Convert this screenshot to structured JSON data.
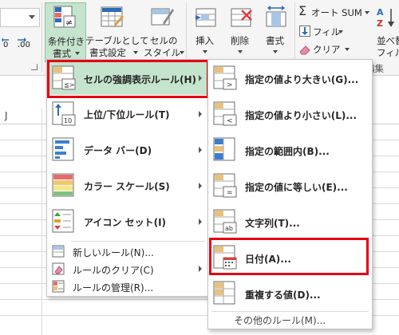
{
  "ribbon": {
    "dropdown_value": "",
    "numfmt_left": "0",
    "numfmt_right": ".00",
    "conditional_formatting_line1": "条件付き",
    "conditional_formatting_line2": "書式",
    "format_as_table_line1": "テーブルとして",
    "format_as_table_line2": "書式設定",
    "cell_styles_line1": "セルの",
    "cell_styles_line2": "スタイル",
    "insert": "挿入",
    "delete": "削除",
    "format": "書式",
    "autosum": "オート SUM",
    "fill": "フィル",
    "clear": "クリア",
    "sort_line1": "並べ替",
    "sort_line2": "フィル",
    "group_editing": "編集"
  },
  "sheet": {
    "column_header": "J"
  },
  "main_menu": {
    "items": [
      {
        "label": "セルの強調表示ルール(H)",
        "has_arrow": true
      },
      {
        "label": "上位/下位ルール(T)",
        "has_arrow": true
      },
      {
        "label": "データ バー(D)",
        "has_arrow": true
      },
      {
        "label": "カラー スケール(S)",
        "has_arrow": true
      },
      {
        "label": "アイコン セット(I)",
        "has_arrow": true
      }
    ],
    "small_items": [
      {
        "label": "新しいルール(N)..."
      },
      {
        "label": "ルールのクリア(C)",
        "has_arrow": true
      },
      {
        "label": "ルールの管理(R)..."
      }
    ]
  },
  "sub_menu": {
    "items": [
      {
        "label": "指定の値より大きい(G)..."
      },
      {
        "label": "指定の値より小さい(L)..."
      },
      {
        "label": "指定の範囲内(B)..."
      },
      {
        "label": "指定の値に等しい(E)..."
      },
      {
        "label": "文字列(T)..."
      },
      {
        "label": "日付(A)..."
      },
      {
        "label": "重複する値(D)..."
      }
    ],
    "more_rules": "その他のルール(M)..."
  },
  "colors": {
    "highlight_red": "#e60012",
    "selected_green": "#c5e4ce",
    "accent_blue": "#2b6cb3"
  }
}
